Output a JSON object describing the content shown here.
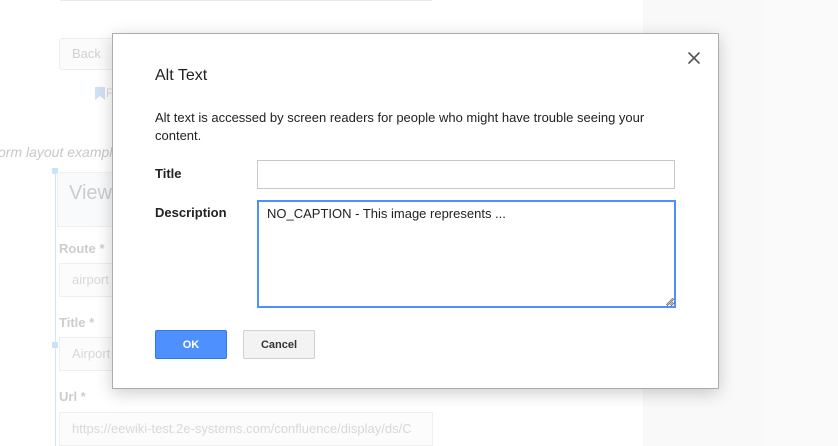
{
  "background": {
    "back_button": "Back",
    "bookmark_text": "F",
    "caption": "orm layout example",
    "form_header": "View",
    "fields": [
      {
        "label": "Route *",
        "value": "airport"
      },
      {
        "label": "Title *",
        "value": "Airport"
      },
      {
        "label": "Url *",
        "value": "https://eewiki-test.2e-systems.com/confluence/display/ds/C"
      }
    ]
  },
  "dialog": {
    "title": "Alt Text",
    "close_icon": "close-icon",
    "description": "Alt text is accessed by screen readers for people who might have trouble seeing your content.",
    "title_label": "Title",
    "title_value": "",
    "description_label": "Description",
    "description_value": "NO_CAPTION - This image represents ...",
    "ok_label": "OK",
    "cancel_label": "Cancel"
  },
  "colors": {
    "primary_button": "#4d90fe",
    "focus_border": "#4d90fe"
  }
}
